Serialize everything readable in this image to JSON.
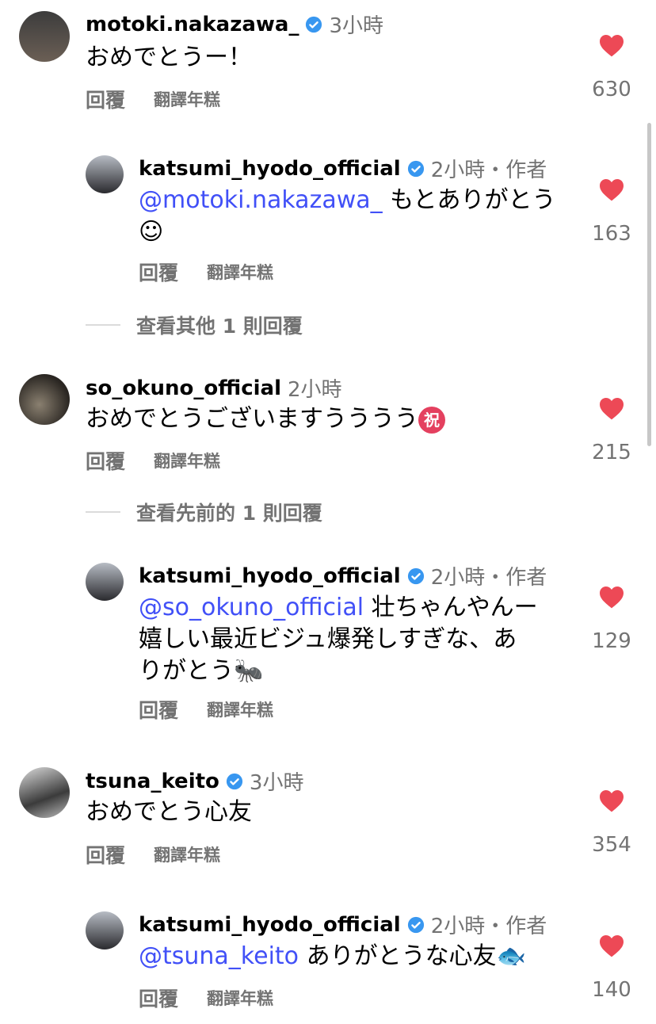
{
  "comments": [
    {
      "username": "motoki.nakazawa_",
      "time": "3小時",
      "author_tag": "",
      "text": "おめでとうー！",
      "reply_label": "回覆",
      "translate_label": "翻譯年糕",
      "likes": "630",
      "avatar_color": "#5a5a5a"
    },
    {
      "username": "katsumi_hyodo_official",
      "time": "2小時・作者",
      "mention": "@motoki.nakazawa_",
      "text": " もとありがとう\n☺",
      "reply_label": "回覆",
      "translate_label": "翻譯年糕",
      "likes": "163",
      "avatar_color": "#8a9099"
    },
    {
      "username": "so_okuno_official",
      "time": "2小時",
      "text": "おめでとうございますうううう",
      "emoji": "祝",
      "reply_label": "回覆",
      "translate_label": "翻譯年糕",
      "likes": "215",
      "avatar_color": "#3a3530"
    },
    {
      "username": "katsumi_hyodo_official",
      "time": "2小時・作者",
      "mention": "@so_okuno_official",
      "text": " 壮ちゃんやんー\n嬉しい最近ビジュ爆発しすぎな、あ\nりがとう🐜",
      "reply_label": "回覆",
      "translate_label": "翻譯年糕",
      "likes": "129",
      "avatar_color": "#8a9099"
    },
    {
      "username": "tsuna_keito",
      "time": "3小時",
      "text": "おめでとう心友",
      "reply_label": "回覆",
      "translate_label": "翻譯年糕",
      "likes": "354",
      "avatar_color": "#777777"
    },
    {
      "username": "katsumi_hyodo_official",
      "time": "2小時・作者",
      "mention": "@tsuna_keito",
      "text": " ありがとうな心友🐟",
      "reply_label": "回覆",
      "translate_label": "翻譯年糕",
      "likes": "140",
      "avatar_color": "#8a9099"
    }
  ],
  "view_more": [
    {
      "label": "查看其他 1 則回覆"
    },
    {
      "label": "查看先前的 1 則回覆"
    }
  ],
  "colors": {
    "like_heart": "#ed4956",
    "mention": "#4150f7",
    "verified": "#3897f0",
    "secondary_text": "#737373"
  }
}
